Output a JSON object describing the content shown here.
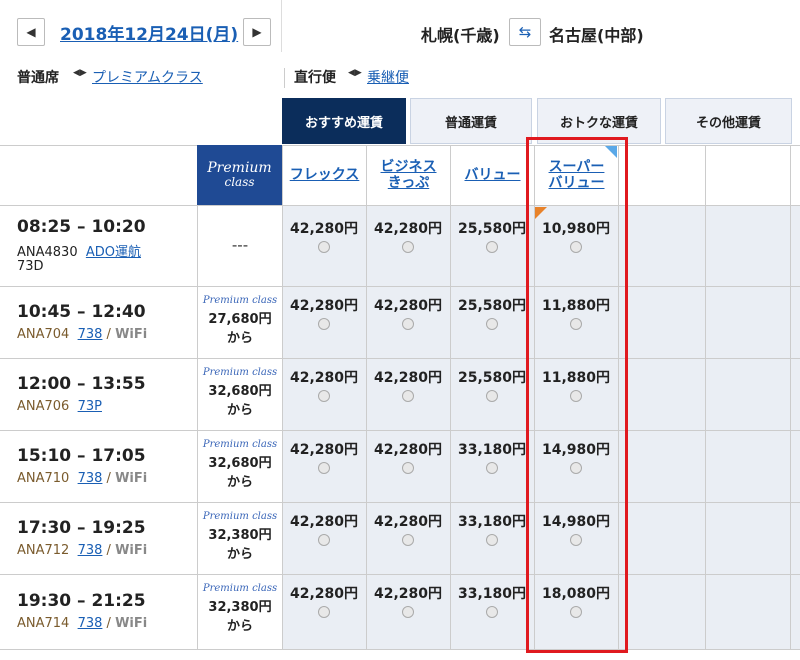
{
  "header": {
    "prev_label": "◀",
    "next_label": "▶",
    "date": "2018年12月24日(月)",
    "from": "札幌(千歳)",
    "to": "名古屋(中部)",
    "swap_label": "⇆"
  },
  "filters": {
    "seat_current": "普通席",
    "seat_alt": "プレミアムクラス",
    "flight_current": "直行便",
    "flight_alt": "乗継便",
    "toggle_glyph": "◀▶"
  },
  "tabs": [
    {
      "label": "おすすめ運賃",
      "active": true
    },
    {
      "label": "普通運賃",
      "active": false
    },
    {
      "label": "おトクな運賃",
      "active": false
    },
    {
      "label": "その他運賃",
      "active": false
    }
  ],
  "premium_header": {
    "line1": "Premium",
    "line2": "class"
  },
  "fare_columns": [
    "フレックス",
    "ビジネス\nきっぷ",
    "バリュー",
    "スーパー\nバリュー"
  ],
  "premium_logo": "Premium class",
  "from_label": "から",
  "flights": [
    {
      "time": "08:25 – 10:20",
      "number": "ANA4830",
      "aircraft": "ADO運航",
      "extra": "73D",
      "wifi": "",
      "premium": "---",
      "prices": [
        "42,280円",
        "42,280円",
        "25,580円",
        "10,980円"
      ]
    },
    {
      "time": "10:45 – 12:40",
      "number": "ANA704",
      "aircraft": "738",
      "extra": "",
      "wifi": "WiFi",
      "premium": "27,680円",
      "prices": [
        "42,280円",
        "42,280円",
        "25,580円",
        "11,880円"
      ]
    },
    {
      "time": "12:00 – 13:55",
      "number": "ANA706",
      "aircraft": "73P",
      "extra": "",
      "wifi": "",
      "premium": "32,680円",
      "prices": [
        "42,280円",
        "42,280円",
        "25,580円",
        "11,880円"
      ]
    },
    {
      "time": "15:10 – 17:05",
      "number": "ANA710",
      "aircraft": "738",
      "extra": "",
      "wifi": "WiFi",
      "premium": "32,680円",
      "prices": [
        "42,280円",
        "42,280円",
        "33,180円",
        "14,980円"
      ]
    },
    {
      "time": "17:30 – 19:25",
      "number": "ANA712",
      "aircraft": "738",
      "extra": "",
      "wifi": "WiFi",
      "premium": "32,380円",
      "prices": [
        "42,280円",
        "42,280円",
        "33,180円",
        "14,980円"
      ]
    },
    {
      "time": "19:30 – 21:25",
      "number": "ANA714",
      "aircraft": "738",
      "extra": "",
      "wifi": "WiFi",
      "premium": "32,380円",
      "prices": [
        "42,280円",
        "42,280円",
        "33,180円",
        "18,080円"
      ]
    }
  ],
  "colors": {
    "navy": "#0b2d5b",
    "premium_blue": "#1f4a94",
    "link_blue": "#1a5fb4",
    "highlight_red": "#e0191f",
    "corner_orange": "#e8822a",
    "corner_blue": "#5aa8e8"
  }
}
